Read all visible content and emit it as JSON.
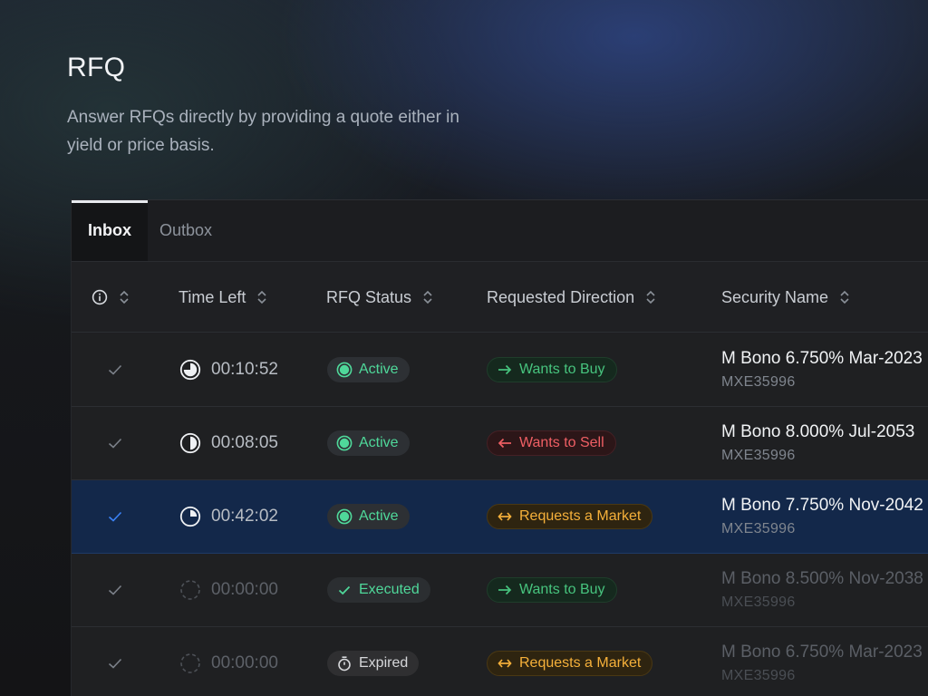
{
  "page": {
    "title": "RFQ",
    "description": "Answer RFQs directly by providing a quote either in yield or price basis."
  },
  "tabs": [
    {
      "label": "Inbox",
      "active": true
    },
    {
      "label": "Outbox",
      "active": false
    }
  ],
  "columns": {
    "info_icon": "info-icon",
    "time_left": "Time Left",
    "rfq_status": "RFQ Status",
    "requested_direction": "Requested Direction",
    "security_name": "Security Name"
  },
  "colors": {
    "accent_blue": "#3b82f6",
    "selected_row": "#13284a",
    "status_green": "#4fd89a",
    "buy_green": "#47c47e",
    "sell_red": "#ef5f64",
    "market_orange": "#f5b03a"
  },
  "rows": [
    {
      "checked": false,
      "time_left": "00:10:52",
      "time_progress": 0.75,
      "status": "Active",
      "direction": "Wants to Buy",
      "security_name": "M Bono 6.750% Mar-2023",
      "security_code": "MXE35996"
    },
    {
      "checked": false,
      "time_left": "00:08:05",
      "time_progress": 0.5,
      "status": "Active",
      "direction": "Wants to Sell",
      "security_name": "M Bono 8.000% Jul-2053",
      "security_code": "MXE35996"
    },
    {
      "checked": true,
      "selected": true,
      "time_left": "00:42:02",
      "time_progress": 0.25,
      "status": "Active",
      "direction": "Requests a Market",
      "security_name": "M Bono 7.750% Nov-2042",
      "security_code": "MXE35996"
    },
    {
      "checked": false,
      "time_left": "00:00:00",
      "time_progress": 0,
      "status": "Executed",
      "direction": "Wants to Buy",
      "security_name": "M Bono 8.500% Nov-2038",
      "security_code": "MXE35996"
    },
    {
      "checked": false,
      "time_left": "00:00:00",
      "time_progress": 0,
      "status": "Expired",
      "direction": "Requests a Market",
      "security_name": "M Bono 6.750% Mar-2023",
      "security_code": "MXE35996"
    }
  ]
}
